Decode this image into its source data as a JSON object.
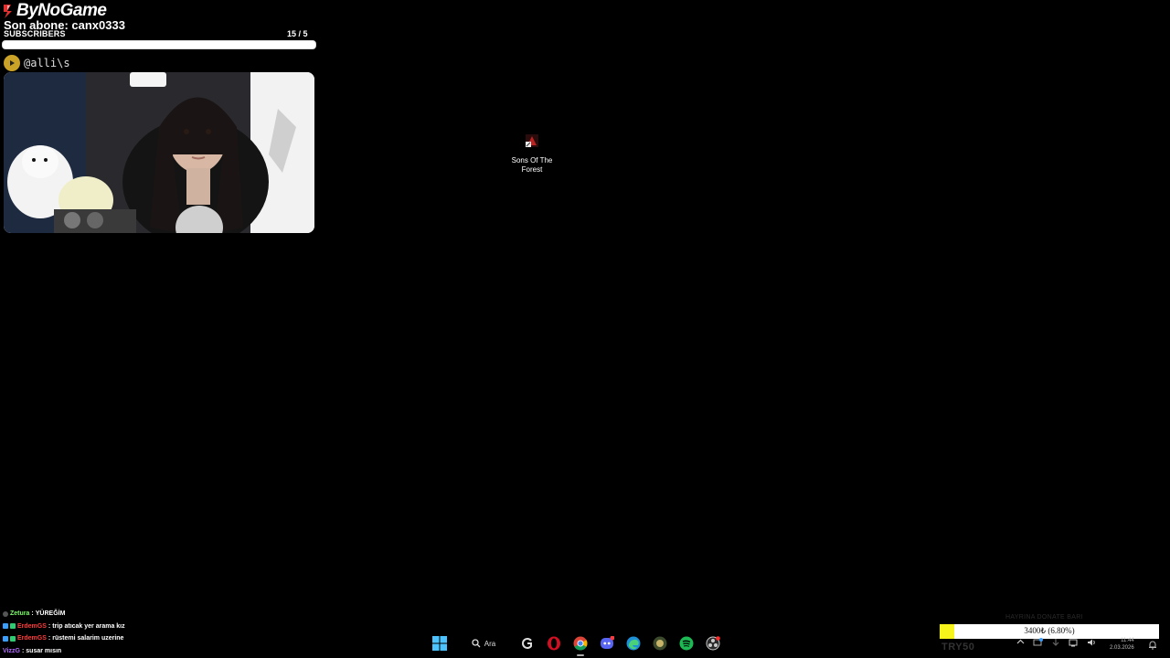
{
  "overlay": {
    "brand": "ByNoGame",
    "last_sub": "Son abone: canx0333",
    "subs_label": "SUBSCRIBERS",
    "subs_count": "15  / 5",
    "subs_progress": 1.0,
    "handle": "@alli\\s"
  },
  "desktop": {
    "icons": [
      {
        "label_line1": "Sons Of The",
        "label_line2": "Forest"
      }
    ]
  },
  "chat": {
    "messages": [
      {
        "user": "Zetura",
        "user_color": "#7CFC6A",
        "sep": " : ",
        "text": "YÜREĞİM"
      },
      {
        "user": "ErdemGS",
        "user_color": "#ff3b3b",
        "sep": " : ",
        "text": "trip atıcak yer arama kız"
      },
      {
        "user": "ErdemGS",
        "user_color": "#ff3b3b",
        "sep": " : ",
        "text": "rüstemi salarim uzerine"
      },
      {
        "user": "VizzG",
        "user_color": "#b36bff",
        "sep": " : ",
        "text": "susar mısın"
      }
    ]
  },
  "taskbar": {
    "search_label": "Ara",
    "apps": [
      "windows-start-icon",
      "search-icon",
      "app-g-icon",
      "opera-icon",
      "chrome-icon",
      "discord-icon",
      "edge-icon",
      "app-circle-icon",
      "spotify-icon",
      "obs-icon"
    ]
  },
  "donate": {
    "title": "HAYRINA DONATE BARI",
    "amount_text": "3400₺ (6.80%)",
    "progress": 0.068,
    "promo": "TRY50"
  },
  "tray": {
    "time": "11:44",
    "date": "2.03.2026"
  },
  "colors": {
    "background": "#000000",
    "donate_fill": "#f7f41b",
    "play_icon": "#c9a227"
  }
}
